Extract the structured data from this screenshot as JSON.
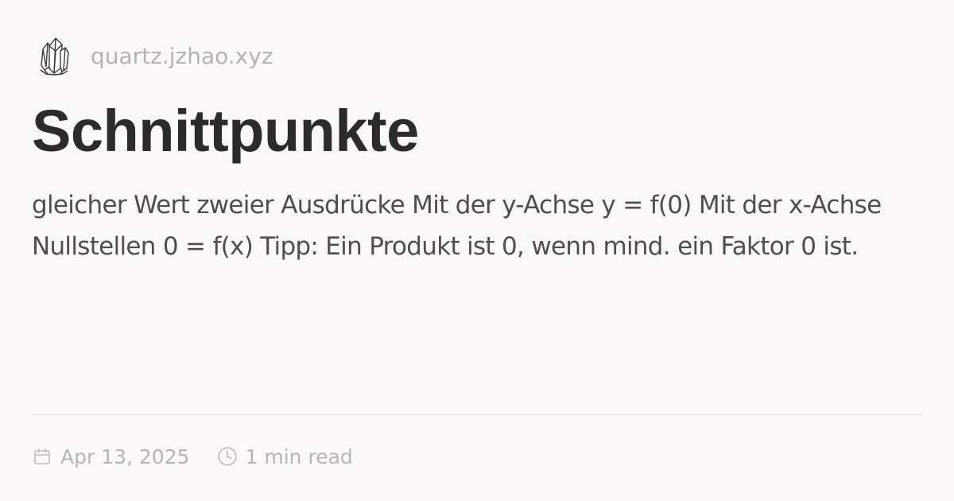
{
  "site": {
    "logo_icon": "crystal-logo-icon",
    "url": "quartz.jzhao.xyz"
  },
  "page": {
    "title": "Schnittpunkte",
    "description": "gleicher Wert zweier Ausdrücke Mit der y-Achse y = f(0) Mit der x-Achse Nullstellen 0 = f(x) Tipp: Ein Produkt ist 0, wenn mind. ein Faktor 0 ist."
  },
  "meta": {
    "date_icon": "calendar-icon",
    "date": "Apr 13, 2025",
    "read_icon": "clock-icon",
    "reading_time": "1 min read"
  },
  "colors": {
    "background": "#faf8f8",
    "title": "#2b2b2b",
    "text": "#4e4e4e",
    "muted": "#b5b5b5",
    "divider": "#e6e4e4"
  }
}
